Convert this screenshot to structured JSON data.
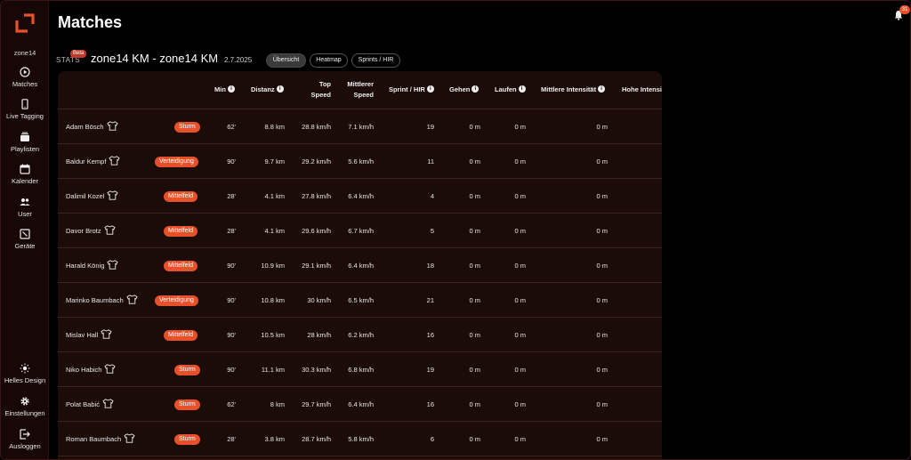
{
  "sidebar": {
    "org_name": "zone14",
    "items": [
      {
        "label": "Matches",
        "icon": "play-circle-icon"
      },
      {
        "label": "Live Tagging",
        "icon": "phone-icon"
      },
      {
        "label": "Playlisten",
        "icon": "playlist-icon"
      },
      {
        "label": "Kalender",
        "icon": "calendar-icon"
      },
      {
        "label": "User",
        "icon": "users-icon"
      },
      {
        "label": "Geräte",
        "icon": "device-icon"
      }
    ],
    "bottom_items": [
      {
        "label": "Helles Design",
        "icon": "sun-icon"
      },
      {
        "label": "Einstellungen",
        "icon": "gear-icon"
      },
      {
        "label": "Ausloggen",
        "icon": "logout-icon"
      }
    ]
  },
  "header": {
    "title": "Matches",
    "notification_count": "31"
  },
  "match": {
    "stats_label": "STATS",
    "beta_label": "Beta",
    "title": "zone14 KM - zone14 KM",
    "date": "2.7.2025",
    "tabs": [
      {
        "label": "Übersicht",
        "active": true
      },
      {
        "label": "Heatmap",
        "active": false
      },
      {
        "label": "Sprints / HIR",
        "active": false
      }
    ]
  },
  "table": {
    "columns": {
      "min": "Min",
      "distanz": "Distanz",
      "top_speed_1": "Top",
      "top_speed_2": "Speed",
      "mittlerer_speed_1": "Mittlerer",
      "mittlerer_speed_2": "Speed",
      "sprint_hir": "Sprint / HIR",
      "gehen": "Gehen",
      "laufen": "Laufen",
      "mittlere_intensitaet": "Mittlere Intensität",
      "hohe_intensitaet": "Hohe Intensi"
    },
    "rows": [
      {
        "name": "Adam Bösch",
        "position": "Sturm",
        "min": "62'",
        "distanz": "8.8 km",
        "top_speed": "28.8 km/h",
        "mittlerer_speed": "7.1 km/h",
        "sprints": "19",
        "gehen": "0 m",
        "laufen": "0 m",
        "mittlere": "0 m"
      },
      {
        "name": "Baldur Kempf",
        "position": "Verteidigung",
        "min": "90'",
        "distanz": "9.7 km",
        "top_speed": "29.2 km/h",
        "mittlerer_speed": "5.6 km/h",
        "sprints": "11",
        "gehen": "0 m",
        "laufen": "0 m",
        "mittlere": "0 m"
      },
      {
        "name": "Dalimil Kozel",
        "position": "Mittelfeld",
        "min": "28'",
        "distanz": "4.1 km",
        "top_speed": "27.8 km/h",
        "mittlerer_speed": "6.4 km/h",
        "sprints": "4",
        "gehen": "0 m",
        "laufen": "0 m",
        "mittlere": "0 m"
      },
      {
        "name": "Davor Brotz",
        "position": "Mittelfeld",
        "min": "28'",
        "distanz": "4.1 km",
        "top_speed": "29.6 km/h",
        "mittlerer_speed": "6.7 km/h",
        "sprints": "5",
        "gehen": "0 m",
        "laufen": "0 m",
        "mittlere": "0 m"
      },
      {
        "name": "Harald König",
        "position": "Mittelfeld",
        "min": "90'",
        "distanz": "10.9 km",
        "top_speed": "29.1 km/h",
        "mittlerer_speed": "6.4 km/h",
        "sprints": "18",
        "gehen": "0 m",
        "laufen": "0 m",
        "mittlere": "0 m"
      },
      {
        "name": "Marinko Baumbach",
        "position": "Verteidigung",
        "min": "90'",
        "distanz": "10.8 km",
        "top_speed": "30 km/h",
        "mittlerer_speed": "6.5 km/h",
        "sprints": "21",
        "gehen": "0 m",
        "laufen": "0 m",
        "mittlere": "0 m"
      },
      {
        "name": "Mislav Hall",
        "position": "Mittelfeld",
        "min": "90'",
        "distanz": "10.5 km",
        "top_speed": "28 km/h",
        "mittlerer_speed": "6.2 km/h",
        "sprints": "16",
        "gehen": "0 m",
        "laufen": "0 m",
        "mittlere": "0 m"
      },
      {
        "name": "Niko Habich",
        "position": "Sturm",
        "min": "90'",
        "distanz": "11.1 km",
        "top_speed": "30.3 km/h",
        "mittlerer_speed": "6.8 km/h",
        "sprints": "19",
        "gehen": "0 m",
        "laufen": "0 m",
        "mittlere": "0 m"
      },
      {
        "name": "Polat Babić",
        "position": "Sturm",
        "min": "62'",
        "distanz": "8 km",
        "top_speed": "29.7 km/h",
        "mittlerer_speed": "6.4 km/h",
        "sprints": "16",
        "gehen": "0 m",
        "laufen": "0 m",
        "mittlere": "0 m"
      },
      {
        "name": "Roman Baumbach",
        "position": "Sturm",
        "min": "28'",
        "distanz": "3.8 km",
        "top_speed": "28.7 km/h",
        "mittlerer_speed": "5.8 km/h",
        "sprints": "6",
        "gehen": "0 m",
        "laufen": "0 m",
        "mittlere": "0 m"
      }
    ]
  },
  "colors": {
    "accent": "#e8502a",
    "sidebar_bg": "#170707",
    "panel_bg": "#1c0c08"
  }
}
